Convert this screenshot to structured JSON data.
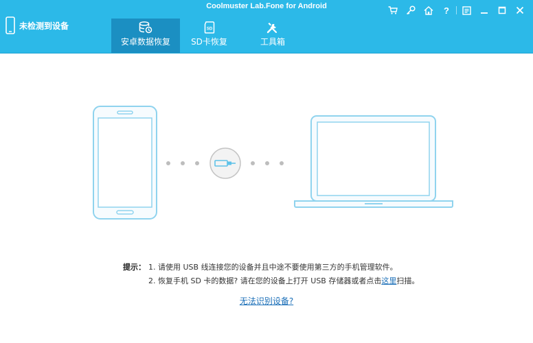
{
  "window": {
    "title": "Coolmuster Lab.Fone for Android"
  },
  "device_status": {
    "label": "未检测到设备"
  },
  "tabs": [
    {
      "label": "安卓数据恢复",
      "icon": "database-restore-icon",
      "active": true
    },
    {
      "label": "SD卡恢复",
      "icon": "sd-card-icon",
      "active": false
    },
    {
      "label": "工具箱",
      "icon": "tools-icon",
      "active": false
    }
  ],
  "window_controls": [
    {
      "icon": "cart-icon",
      "glyph": "🛒"
    },
    {
      "icon": "key-icon",
      "glyph": "🔑"
    },
    {
      "icon": "home-icon",
      "glyph": "⌂"
    },
    {
      "icon": "help-icon",
      "glyph": "?"
    },
    {
      "icon": "feedback-icon",
      "glyph": "▤"
    },
    {
      "icon": "minimize-icon",
      "glyph": "—"
    },
    {
      "icon": "maximize-icon",
      "glyph": "□"
    },
    {
      "icon": "close-icon",
      "glyph": "✕"
    }
  ],
  "tips": {
    "label": "提示：",
    "line1": "1. 请使用 USB 线连接您的设备并且中途不要使用第三方的手机管理软件。",
    "line2_prefix": "2. 恢复手机 SD 卡的数据? 请在您的设备上打开 USB 存储器或者点击",
    "line2_link": "这里",
    "line2_suffix": "扫描。"
  },
  "cant_recognize_link": "无法识别设备?",
  "colors": {
    "header": "#2cb9e8",
    "active_tab": "#1b8fc2",
    "illustration_stroke": "#8fd3ee",
    "link": "#1b6fb8"
  }
}
